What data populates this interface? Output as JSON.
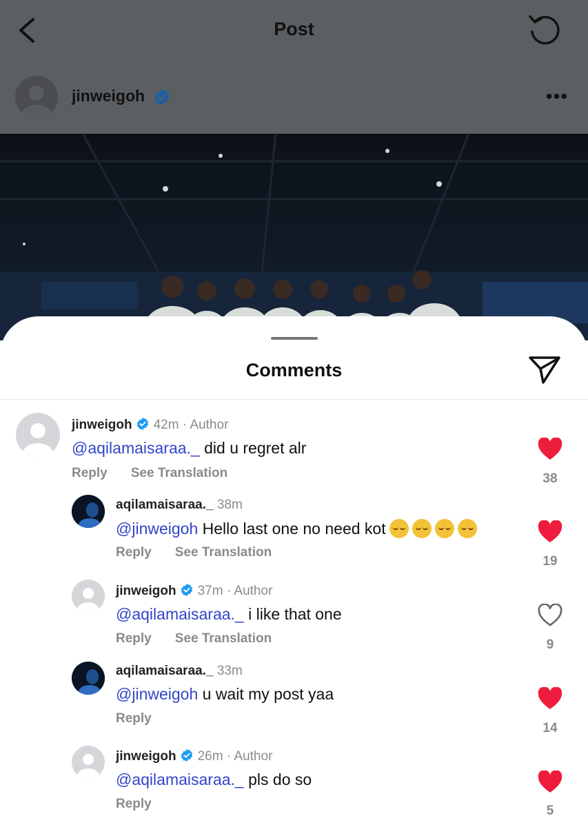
{
  "header": {
    "title": "Post",
    "author": "jinweigoh"
  },
  "comments_sheet": {
    "title": "Comments",
    "reply_label": "Reply",
    "translate_label": "See Translation",
    "items": [
      {
        "username": "jinweigoh",
        "verified": true,
        "time": "42m",
        "author_tag": "· Author",
        "mention": "@aqilamaisaraa._",
        "text": "did u regret alr",
        "likes": "38",
        "liked": true,
        "has_translation": true
      },
      {
        "username": "aqilamaisaraa._",
        "verified": false,
        "time": "38m",
        "author_tag": "",
        "mention": "@jinweigoh",
        "text": "Hello last one no need kot",
        "emoji_count": 4,
        "likes": "19",
        "liked": true,
        "has_translation": true
      },
      {
        "username": "jinweigoh",
        "verified": true,
        "time": "37m",
        "author_tag": "· Author",
        "mention": "@aqilamaisaraa._",
        "text": "i like that one",
        "likes": "9",
        "liked": false,
        "has_translation": true
      },
      {
        "username": "aqilamaisaraa._",
        "verified": false,
        "time": "33m",
        "author_tag": "",
        "mention": "@jinweigoh",
        "text": "u wait my post yaa",
        "likes": "14",
        "liked": true,
        "has_translation": false
      },
      {
        "username": "jinweigoh",
        "verified": true,
        "time": "26m",
        "author_tag": "· Author",
        "mention": "@aqilamaisaraa._",
        "text": "pls do so",
        "likes": "5",
        "liked": true,
        "has_translation": false
      }
    ]
  },
  "icons": {
    "back": "chevron-left-icon",
    "refresh": "refresh-icon",
    "more": "more-horizontal-icon",
    "share": "send-icon",
    "verified": "verified-badge-icon",
    "like": "heart-icon"
  },
  "colors": {
    "mention": "#3145c8",
    "like_red": "#ee1d3d",
    "verified_blue": "#1d9bf0",
    "muted": "#8a8a8a"
  }
}
